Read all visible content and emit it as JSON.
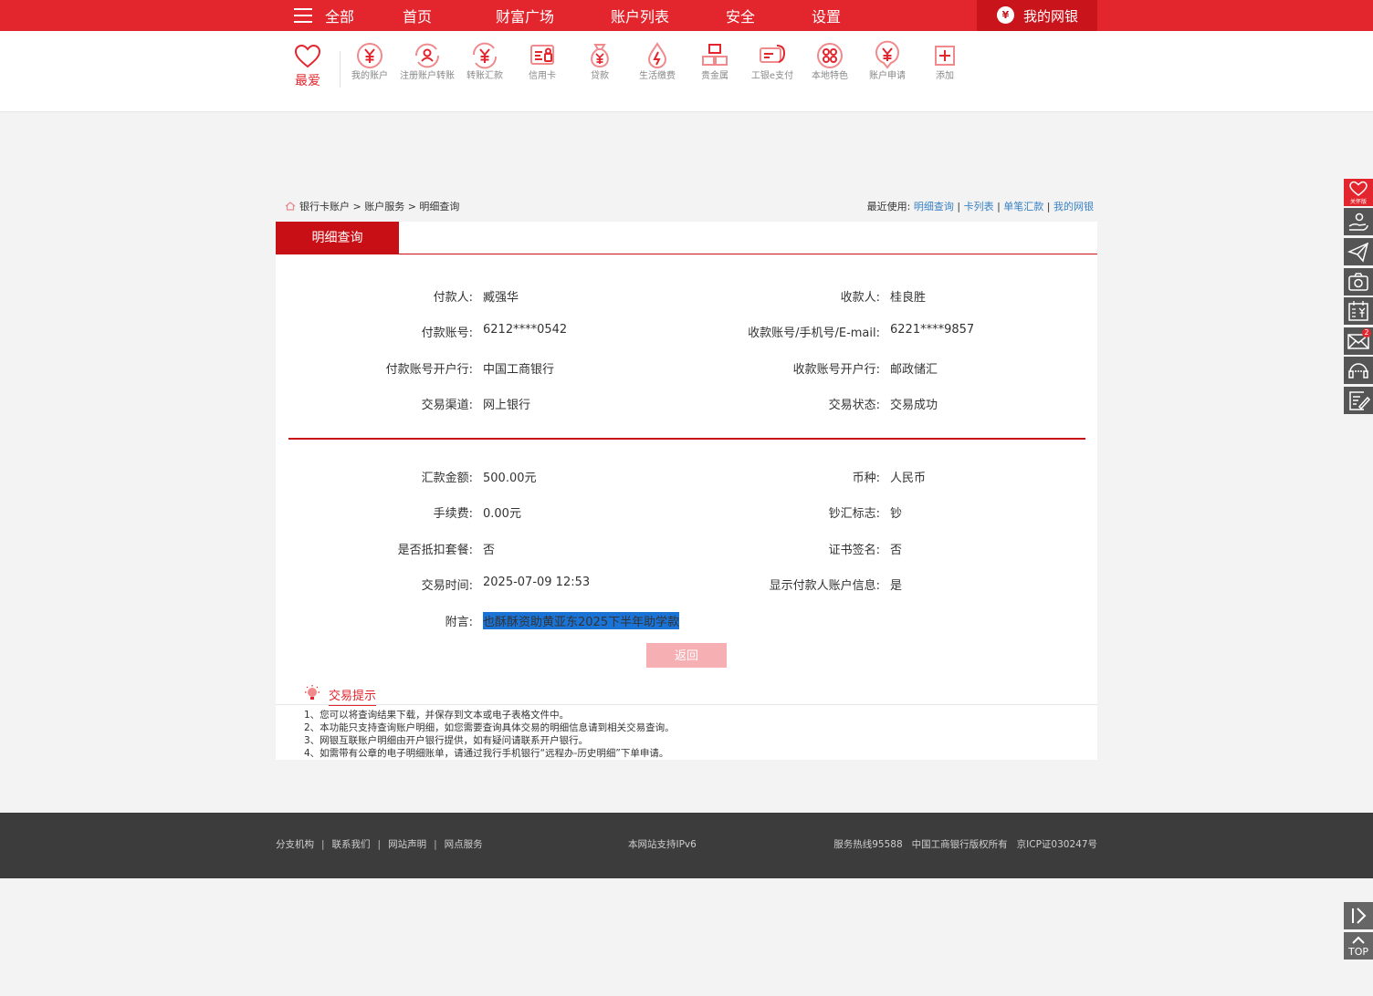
{
  "top_nav": {
    "items": [
      "全部",
      "首页",
      "财富广场",
      "账户列表",
      "安全",
      "设置"
    ],
    "my_bank": "我的网银"
  },
  "shortcuts": {
    "favorite": "最爱",
    "items": [
      {
        "label": "我的账户",
        "icon": "yen-coin-icon"
      },
      {
        "label": "注册账户转账",
        "icon": "register-transfer-icon"
      },
      {
        "label": "转账汇款",
        "icon": "transfer-icon"
      },
      {
        "label": "信用卡",
        "icon": "credit-card-icon"
      },
      {
        "label": "贷款",
        "icon": "money-bag-icon"
      },
      {
        "label": "生活缴费",
        "icon": "drop-icon"
      },
      {
        "label": "贵金属",
        "icon": "gold-bars-icon"
      },
      {
        "label": "工银e支付",
        "icon": "epay-icon"
      },
      {
        "label": "本地特色",
        "icon": "local-icon"
      },
      {
        "label": "账户申请",
        "icon": "apply-icon"
      },
      {
        "label": "添加",
        "icon": "add-icon"
      }
    ]
  },
  "breadcrumb": {
    "path": "银行卡账户 > 账户服务 > 明细查询"
  },
  "recent": {
    "label": "最近使用:",
    "links": [
      "明细查询",
      "卡列表",
      "单笔汇款",
      "我的网银"
    ]
  },
  "detail": {
    "tab": "明细查询",
    "fields": [
      {
        "k": "付款人:",
        "v": "臧强华"
      },
      {
        "k": "收款人:",
        "v": "桂良胜"
      },
      {
        "k": "付款账号:",
        "v": "6212****0542"
      },
      {
        "k": "收款账号/手机号/E-mail:",
        "v": "6221****9857"
      },
      {
        "k": "付款账号开户行:",
        "v": "中国工商银行"
      },
      {
        "k": "收款账号开户行:",
        "v": "邮政储汇"
      },
      {
        "k": "交易渠道:",
        "v": "网上银行"
      },
      {
        "k": "交易状态:",
        "v": "交易成功"
      },
      {
        "k": "汇款金额:",
        "v": "500.00元"
      },
      {
        "k": "币种:",
        "v": "人民币"
      },
      {
        "k": "手续费:",
        "v": "0.00元"
      },
      {
        "k": "钞汇标志:",
        "v": "钞"
      },
      {
        "k": "是否抵扣套餐:",
        "v": "否"
      },
      {
        "k": "证书签名:",
        "v": "否"
      },
      {
        "k": "交易时间:",
        "v": "2025-07-09 12:53"
      },
      {
        "k": "显示付款人账户信息:",
        "v": "是"
      },
      {
        "k": "附言:",
        "v": "也酥酥资助黄亚东2025下半年助学款"
      }
    ],
    "back_button": "返回"
  },
  "tips": {
    "title": "交易提示",
    "lines": [
      "1、您可以将查询结果下载，并保存到文本或电子表格文件中。",
      "2、本功能只支持查询账户明细，如您需要查询具体交易的明细信息请到相关交易查询。",
      "3、网银互联账户明细由开户银行提供，如有疑问请联系开户银行。",
      "4、如需带有公章的电子明细账单，请通过我行手机银行“远程办-历史明细”下单申请。"
    ]
  },
  "footer": {
    "links": [
      "分支机构",
      "联系我们",
      "网站声明",
      "网点服务"
    ],
    "ipv6": "本网站支持IPv6",
    "hotline": "服务热线95588",
    "copyright": "中国工商银行版权所有",
    "icp": "京ICP证030247号"
  },
  "side": {
    "care_label": "关怀版",
    "mail_badge": "2",
    "top_label": "TOP"
  }
}
